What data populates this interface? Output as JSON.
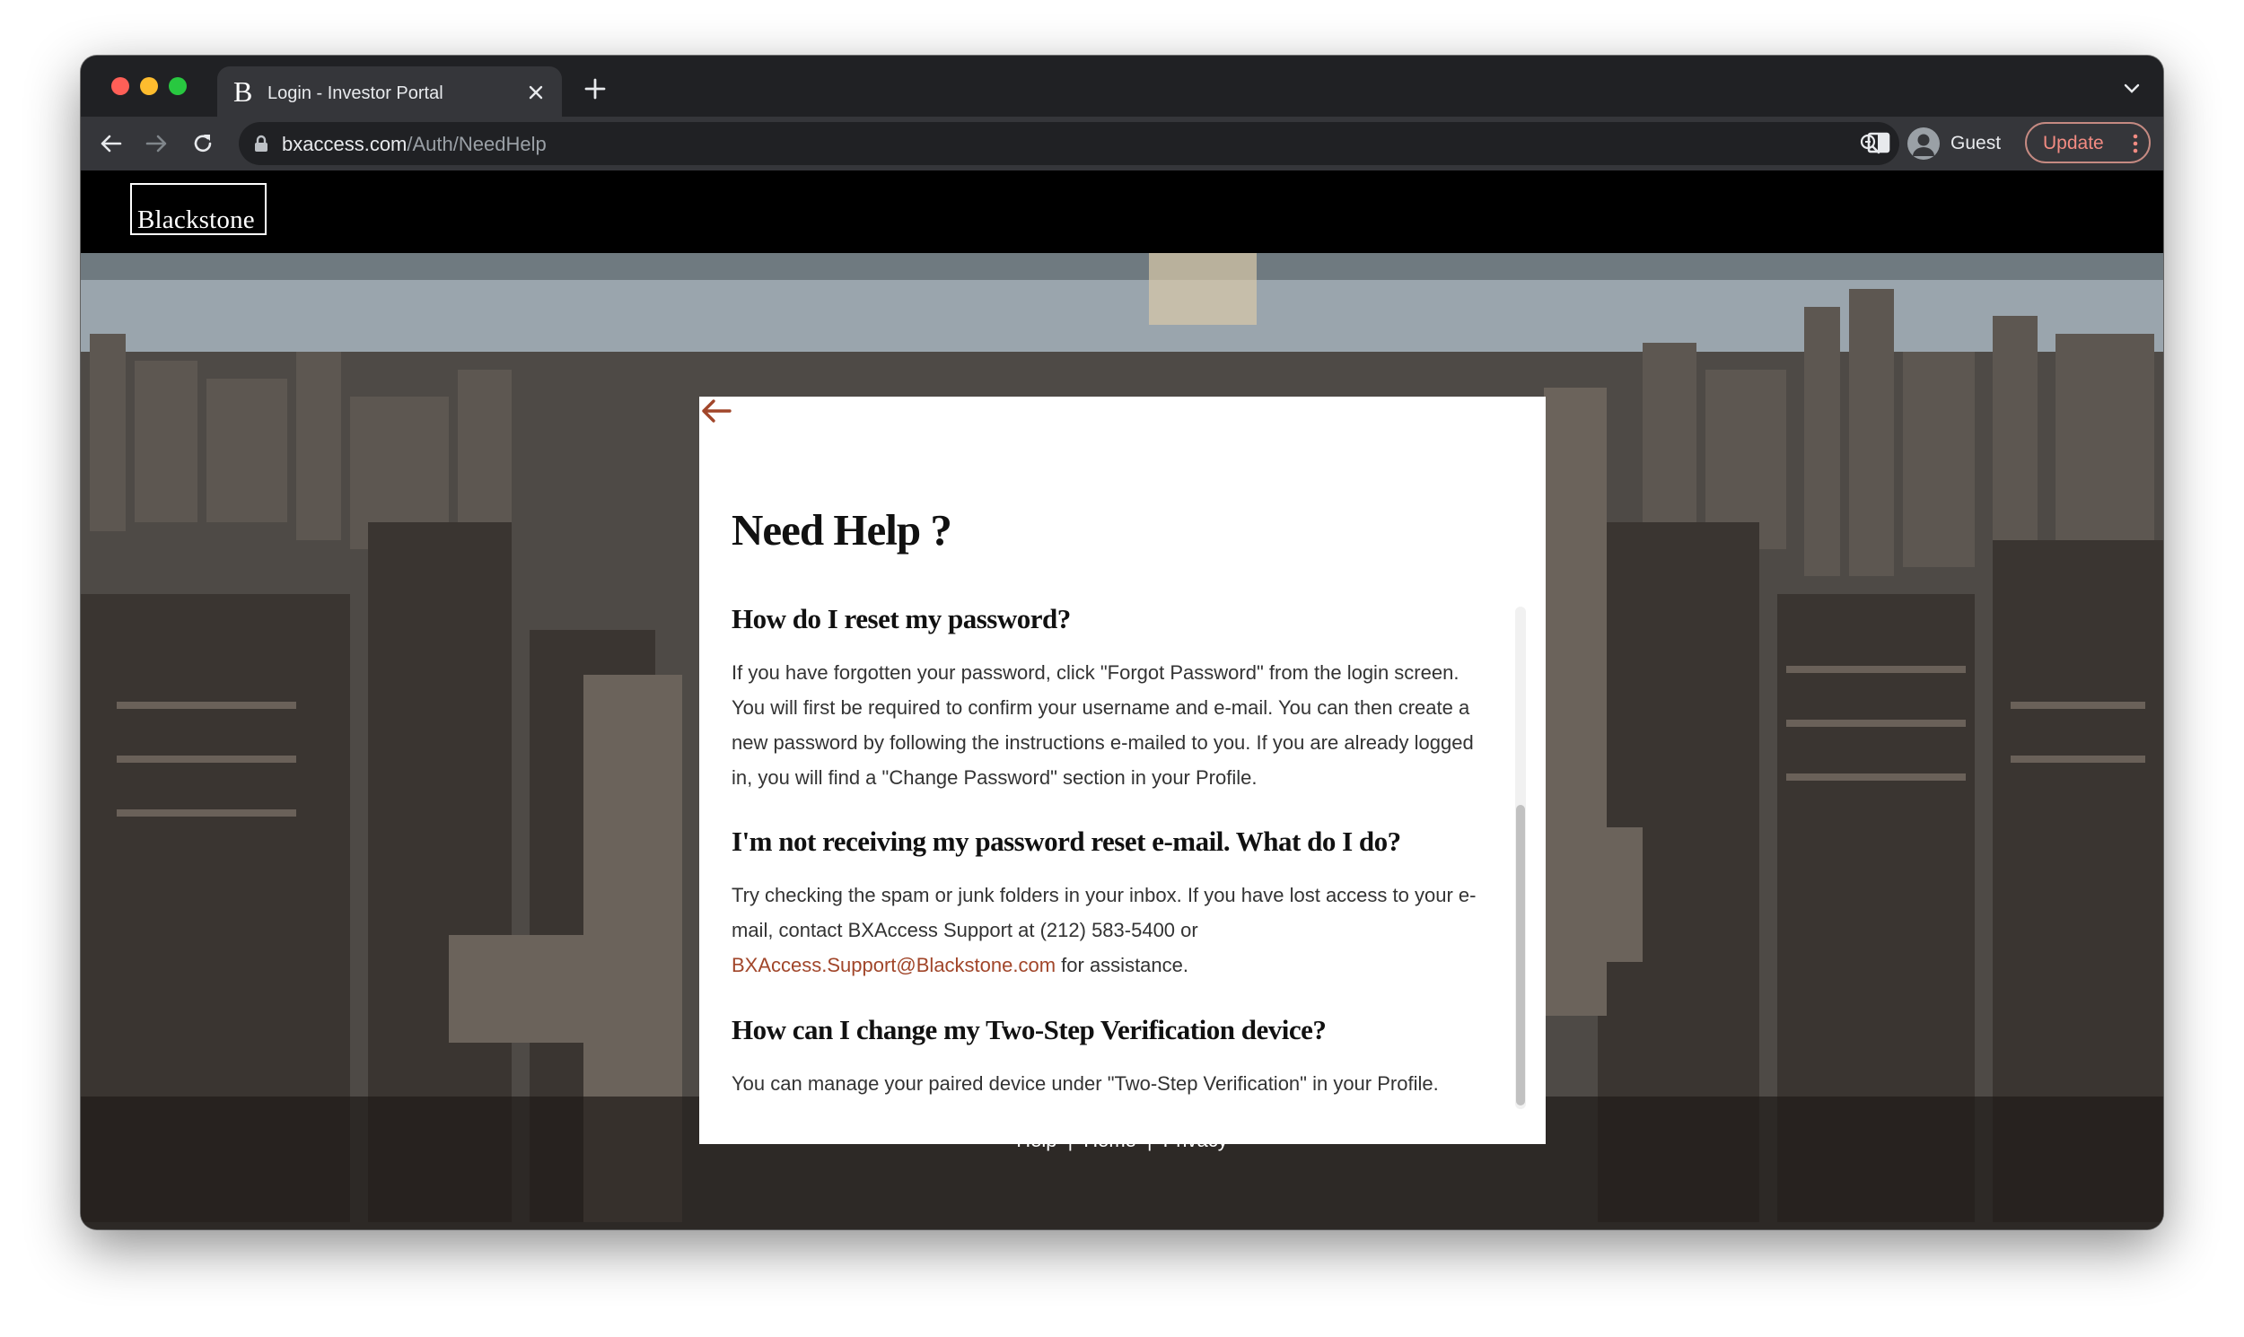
{
  "browser": {
    "tab_title": "Login - Investor Portal",
    "favicon_letter": "B",
    "url_host": "bxaccess.com",
    "url_path": "/Auth/NeedHelp",
    "profile_label": "Guest",
    "update_label": "Update"
  },
  "site": {
    "logo_text": "Blackstone"
  },
  "help": {
    "title": "Need Help ?",
    "faqs": [
      {
        "question": "How do I reset my password?",
        "answer": "If you have forgotten your password, click \"Forgot Password\" from the login screen. You will first be required to confirm your username and e-mail. You can then create a new password by following the instructions e-mailed to you. If you are already logged in, you will find a \"Change Password\" section in your Profile."
      },
      {
        "question": "I'm not receiving my password reset e-mail. What do I do?",
        "answer_before": "Try checking the spam or junk folders in your inbox. If you have lost access to your e-mail, contact BXAccess Support at (212) 583-5400 or ",
        "email": "BXAccess.Support@Blackstone.com",
        "answer_after": " for assistance."
      },
      {
        "question": "How can I change my Two-Step Verification device?",
        "answer": "You can manage your paired device under \"Two-Step Verification\" in your Profile."
      }
    ]
  },
  "footer": {
    "links": [
      "Help",
      "Home",
      "Privacy"
    ],
    "separator": "|"
  },
  "colors": {
    "accent": "#a1462a",
    "header_bg": "#000000",
    "browser_frame": "#202124"
  }
}
